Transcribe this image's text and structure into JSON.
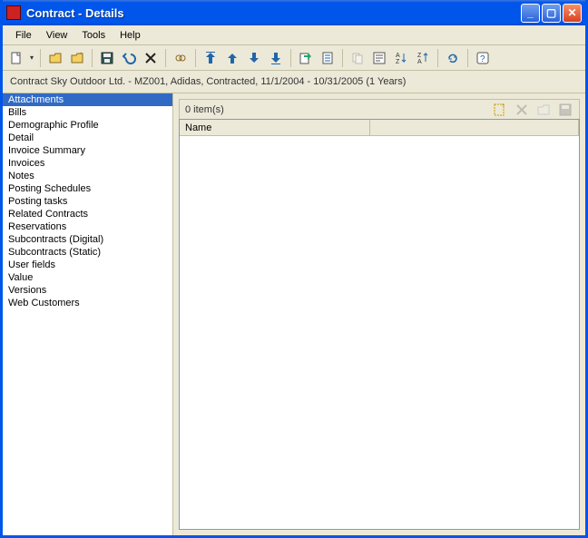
{
  "titlebar": {
    "title": "Contract - Details"
  },
  "menu": {
    "file": "File",
    "view": "View",
    "tools": "Tools",
    "help": "Help"
  },
  "breadcrumb": {
    "text": "Contract  Sky Outdoor Ltd. -  MZ001, Adidas, Contracted, 11/1/2004 - 10/31/2005 (1 Years)"
  },
  "sidebar": {
    "items": [
      "Attachments",
      "Bills",
      "Demographic Profile",
      "Detail",
      "Invoice Summary",
      "Invoices",
      "Notes",
      "Posting Schedules",
      "Posting tasks",
      "Related Contracts",
      "Reservations",
      "Subcontracts (Digital)",
      "Subcontracts (Static)",
      "User fields",
      "Value",
      "Versions",
      "Web Customers"
    ],
    "selected_index": 0
  },
  "main": {
    "status": "0 item(s)",
    "columns": {
      "name": "Name"
    }
  }
}
